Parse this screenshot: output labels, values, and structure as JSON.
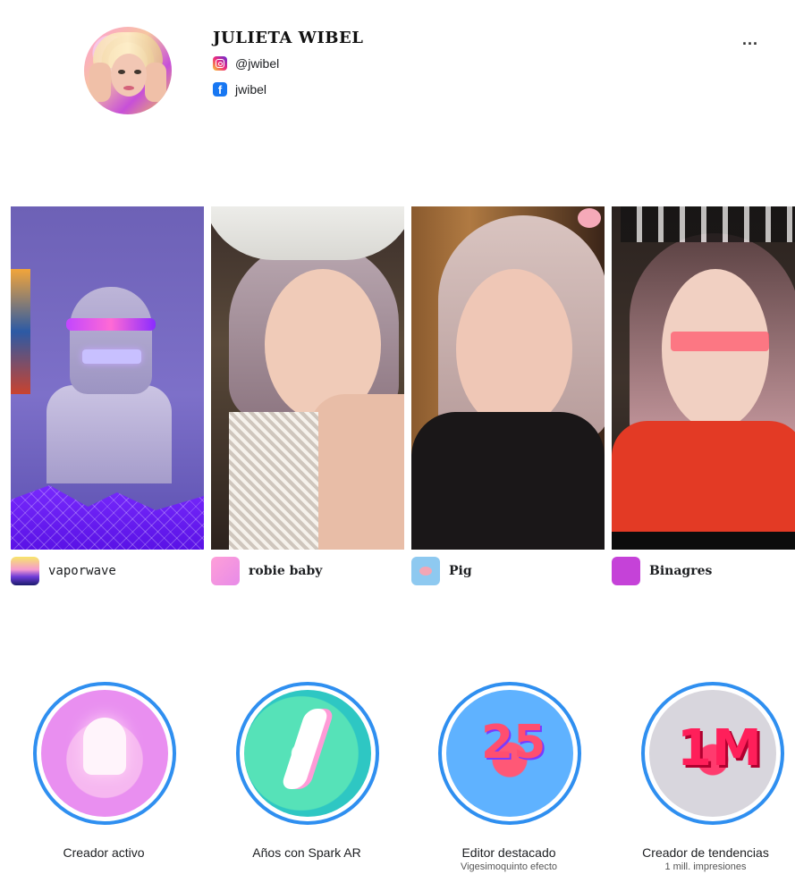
{
  "profile": {
    "name": "JULIETA WIBEL",
    "instagram": "@jwibel",
    "facebook": "jwibel",
    "more_label": "..."
  },
  "effects": [
    {
      "name": "vaporwave"
    },
    {
      "name": "robie baby"
    },
    {
      "name": "Pig"
    },
    {
      "name": "Binagres"
    }
  ],
  "badges": [
    {
      "title": "Creador activo",
      "subtitle": ""
    },
    {
      "title": "Años con Spark AR",
      "subtitle": ""
    },
    {
      "title": "Editor destacado",
      "subtitle": "Vigesimoquinto efecto",
      "glyph": "25"
    },
    {
      "title": "Creador de tendencias",
      "subtitle": "1 mill. impresiones",
      "glyph": "1M"
    }
  ],
  "colors": {
    "badge_ring": "#2f8ff0",
    "facebook": "#1877f2"
  },
  "icons": {
    "instagram": "instagram-icon",
    "facebook": "facebook-icon",
    "more": "more-options-icon"
  }
}
